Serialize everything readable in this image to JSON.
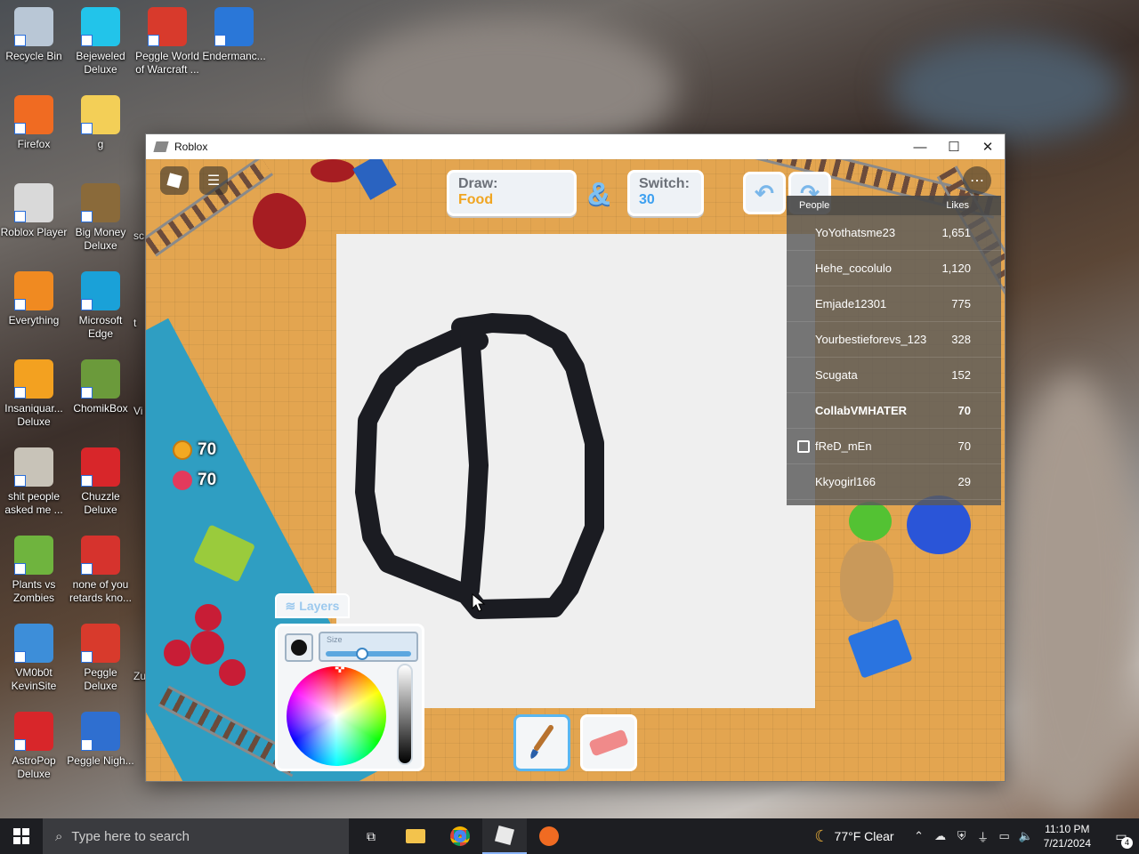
{
  "desktop": {
    "icons": [
      {
        "label": "Recycle Bin",
        "icon": "recycle-bin-icon",
        "color": "#b9c7d6"
      },
      {
        "label": "Bejeweled Deluxe",
        "icon": "gem-icon",
        "color": "#22c4ea"
      },
      {
        "label": "Peggle World of Warcraft ...",
        "icon": "peggle-icon",
        "color": "#d83a2c"
      },
      {
        "label": "Endermanc...",
        "icon": "window-icon",
        "color": "#2a77d8"
      },
      {
        "label": "Firefox",
        "icon": "firefox-icon",
        "color": "#f06b22"
      },
      {
        "label": "g",
        "icon": "folder-icon",
        "color": "#f3cf57"
      },
      {
        "label": "Roblox Player",
        "icon": "roblox-icon",
        "color": "#d9d9d9"
      },
      {
        "label": "Big Money Deluxe",
        "icon": "money-bag-icon",
        "color": "#8a6a3a"
      },
      {
        "label": "Everything",
        "icon": "magnifier-icon",
        "color": "#f08a21"
      },
      {
        "label": "Microsoft Edge",
        "icon": "edge-icon",
        "color": "#1aa1d8"
      },
      {
        "label": "Insaniquar... Deluxe",
        "icon": "fish-icon",
        "color": "#f3a120"
      },
      {
        "label": "ChomikBox",
        "icon": "hamster-icon",
        "color": "#6b9a3b"
      },
      {
        "label": "shit people asked me ...",
        "icon": "document-icon",
        "color": "#c8c3b8"
      },
      {
        "label": "Chuzzle Deluxe",
        "icon": "chuzzle-icon",
        "color": "#d8262a"
      },
      {
        "label": "Plants vs Zombies",
        "icon": "plant-icon",
        "color": "#6fb43e"
      },
      {
        "label": "none of you retards kno...",
        "icon": "shark-icon",
        "color": "#d6332d"
      },
      {
        "label": "VM0b0t KevinSite",
        "icon": "globe-icon",
        "color": "#3d8ed9"
      },
      {
        "label": "Peggle Deluxe",
        "icon": "peggle-icon",
        "color": "#d83a2c"
      },
      {
        "label": "AstroPop Deluxe",
        "icon": "astropop-icon",
        "color": "#d8262a"
      },
      {
        "label": "Peggle Nigh...",
        "icon": "peggle-icon",
        "color": "#2f6fd0"
      }
    ],
    "partial_labels": [
      "sc",
      "t",
      "Vi",
      "Zu"
    ]
  },
  "window": {
    "title": "Roblox",
    "minimize": "—",
    "maximize": "☐",
    "close": "✕"
  },
  "game": {
    "draw_label": "Draw:",
    "draw_value": "Food",
    "amp": "&",
    "switch_label": "Switch:",
    "switch_value": "30",
    "coins": "70",
    "hearts": "70",
    "layers_label": "Layers",
    "size_label": "Size",
    "size_value": 0.4,
    "brush_color": "#111111",
    "chat_icon": "chat-icon",
    "menu_icon": "roblox-menu-icon",
    "more_icon": "more-icon"
  },
  "leaderboard": {
    "col_people": "People",
    "col_likes": "Likes",
    "rows": [
      {
        "name": "YoYothatsme23",
        "likes": "1,651"
      },
      {
        "name": "Hehe_cocolulo",
        "likes": "1,120"
      },
      {
        "name": "Emjade12301",
        "likes": "775"
      },
      {
        "name": "Yourbestieforevs_123",
        "likes": "328"
      },
      {
        "name": "Scugata",
        "likes": "152"
      },
      {
        "name": "CollabVMHATER",
        "likes": "70"
      },
      {
        "name": "fReD_mEn",
        "likes": "70"
      },
      {
        "name": "Kkyogirl166",
        "likes": "29"
      }
    ]
  },
  "taskbar": {
    "search_placeholder": "Type here to search",
    "weather": "77°F  Clear",
    "time": "11:10 PM",
    "date": "7/21/2024",
    "notifications": "4"
  }
}
